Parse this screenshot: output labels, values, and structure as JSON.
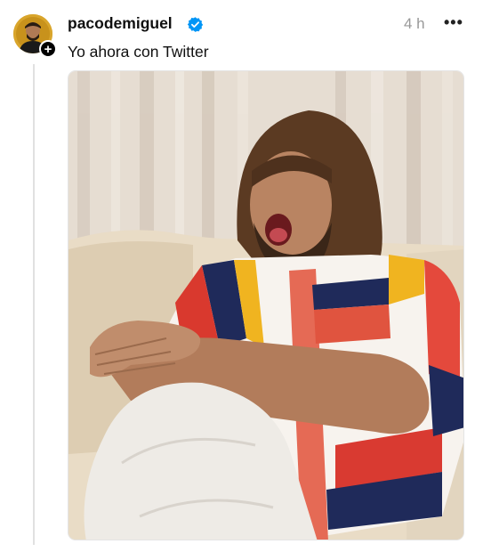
{
  "post": {
    "username": "pacodemiguel",
    "time": "4 h",
    "more_label": "•••",
    "caption": "Yo ahora con Twitter",
    "follow_symbol": "+",
    "icons": {
      "avatar": "avatar",
      "follow": "plus-icon",
      "verified": "verified-badge-icon",
      "more": "more-options-icon"
    },
    "colors": {
      "verified": "#0095f6",
      "avatar_bg": "#d9a52b",
      "thread_line": "#e1e1e1",
      "time": "#999999"
    }
  }
}
